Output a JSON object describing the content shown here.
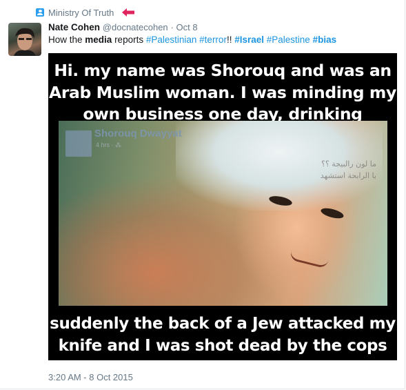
{
  "context": {
    "label": "Ministry Of Truth"
  },
  "tweet": {
    "author_name": "Nate Cohen",
    "author_handle": "@docnatecohen",
    "separator": "·",
    "date": "Oct 8",
    "text_parts": {
      "p1": "How the ",
      "p2": "media",
      "p3": " reports ",
      "p4": "#Palestinian",
      "p5": " ",
      "p6": "#terror",
      "p7": "!! ",
      "p8": "#Israel",
      "p9": " ",
      "p10": "#Palestine",
      "p11": " ",
      "p12": "#bias"
    },
    "timestamp": "3:20 AM - 8 Oct 2015"
  },
  "media": {
    "top_line1": "Hi. my name was Shorouq and was an",
    "top_line2": "Arab Muslim woman. I was minding my",
    "top_line3": "own business one day, drinking coke....",
    "bottom_line1": "suddenly the back of a Jew attacked my",
    "bottom_line2": "knife and I was shot dead by the cops",
    "photo_name": "Shorouq Dwayyat",
    "photo_meta": "4 hrs · ⁂",
    "photo_arabic1": "ما لون رالبيجة ؟؟",
    "photo_arabic2": "با الرابحة استشهد"
  },
  "colors": {
    "link": "#1b95e0",
    "meta": "#657786",
    "accent_arrow": "#e0245e",
    "context_icon": "#2b9ef0"
  },
  "icons": [
    "user-icon",
    "red-arrow-icon"
  ]
}
